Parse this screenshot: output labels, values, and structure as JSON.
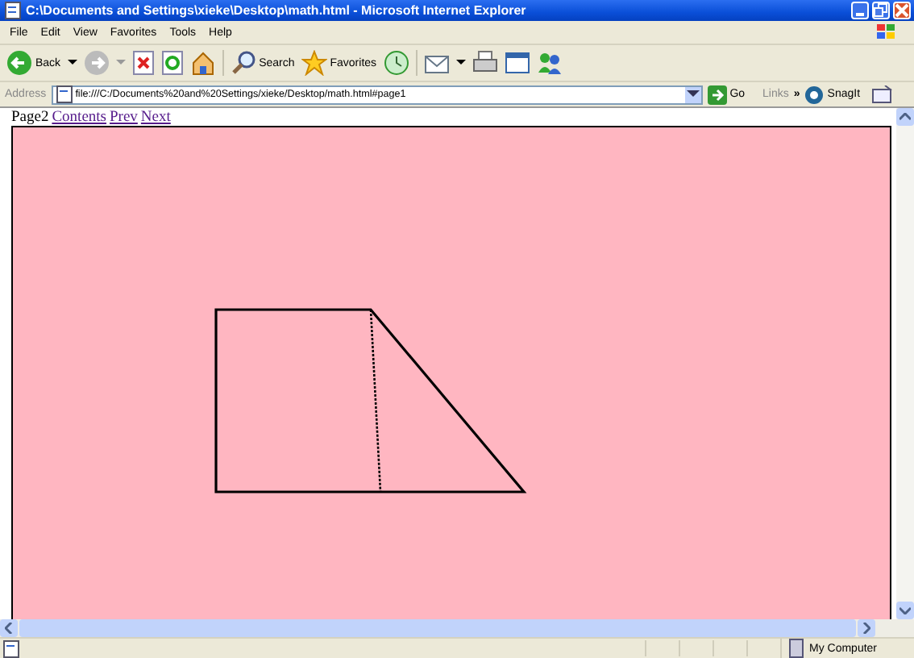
{
  "window": {
    "title": "C:\\Documents and Settings\\xieke\\Desktop\\math.html - Microsoft Internet Explorer"
  },
  "menu": [
    "File",
    "Edit",
    "View",
    "Favorites",
    "Tools",
    "Help"
  ],
  "toolbar": {
    "back": "Back",
    "search": "Search",
    "favorites": "Favorites"
  },
  "address": {
    "label": "Address",
    "value": "file:///C:/Documents%20and%20Settings/xieke/Desktop/math.html#page1",
    "go": "Go",
    "links": "Links",
    "more": "»",
    "snagit": "SnagIt"
  },
  "page": {
    "heading": "Page2",
    "links": [
      "Contents",
      "Prev",
      "Next"
    ]
  },
  "status_bar": {
    "zone": "My Computer"
  }
}
